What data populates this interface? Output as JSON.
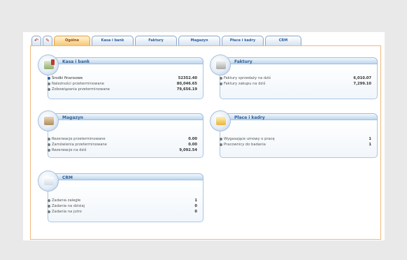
{
  "tabs": [
    {
      "label": "",
      "icon": "back-arrow-icon"
    },
    {
      "label": "",
      "icon": "edit-icon"
    },
    {
      "label": "Ogólne"
    },
    {
      "label": "Kasa i bank"
    },
    {
      "label": "Faktury"
    },
    {
      "label": "Magazyn"
    },
    {
      "label": "Płace i kadry"
    },
    {
      "label": "CRM"
    }
  ],
  "active_tab": "Ogólne",
  "panels": {
    "kasa": {
      "title": "Kasa i bank",
      "icon": "cash-register-icon",
      "rows": [
        {
          "label": "Środki finansowe",
          "value": "52352.40"
        },
        {
          "label": "Należności przeterminowane",
          "value": "80,046.65"
        },
        {
          "label": "Zobowiązania przeterminowane",
          "value": "79,656.19"
        }
      ]
    },
    "faktury": {
      "title": "Faktury",
      "icon": "invoice-printer-icon",
      "rows": [
        {
          "label": "Faktury sprzedaży na dziś",
          "value": "6,010.07"
        },
        {
          "label": "Faktury zakupu na dziś",
          "value": "7,299.10"
        }
      ]
    },
    "magazyn": {
      "title": "Magazyn",
      "icon": "warehouse-boxes-icon",
      "rows": [
        {
          "label": "Rezerwacje przeterminowane",
          "value": "0.00"
        },
        {
          "label": "Zamówienia przeterminowane",
          "value": "0.00"
        },
        {
          "label": "Rezerwacje na dziś",
          "value": "9,092.54"
        }
      ]
    },
    "place": {
      "title": "Płace i kadry",
      "icon": "payroll-money-icon",
      "rows": [
        {
          "label": "Wygasające umowy o pracę",
          "value": "1"
        },
        {
          "label": "Pracownicy do badania",
          "value": "1"
        }
      ]
    },
    "crm": {
      "title": "CRM",
      "icon": "crm-notes-icon",
      "rows": [
        {
          "label": "Zadania zaległe",
          "value": "1"
        },
        {
          "label": "Zadania na dzisiaj",
          "value": "0"
        },
        {
          "label": "Zadania na jutro",
          "value": "0"
        }
      ]
    }
  },
  "colors": {
    "accent_orange": "#f1b77a",
    "panel_blue": "#2f5e96"
  }
}
